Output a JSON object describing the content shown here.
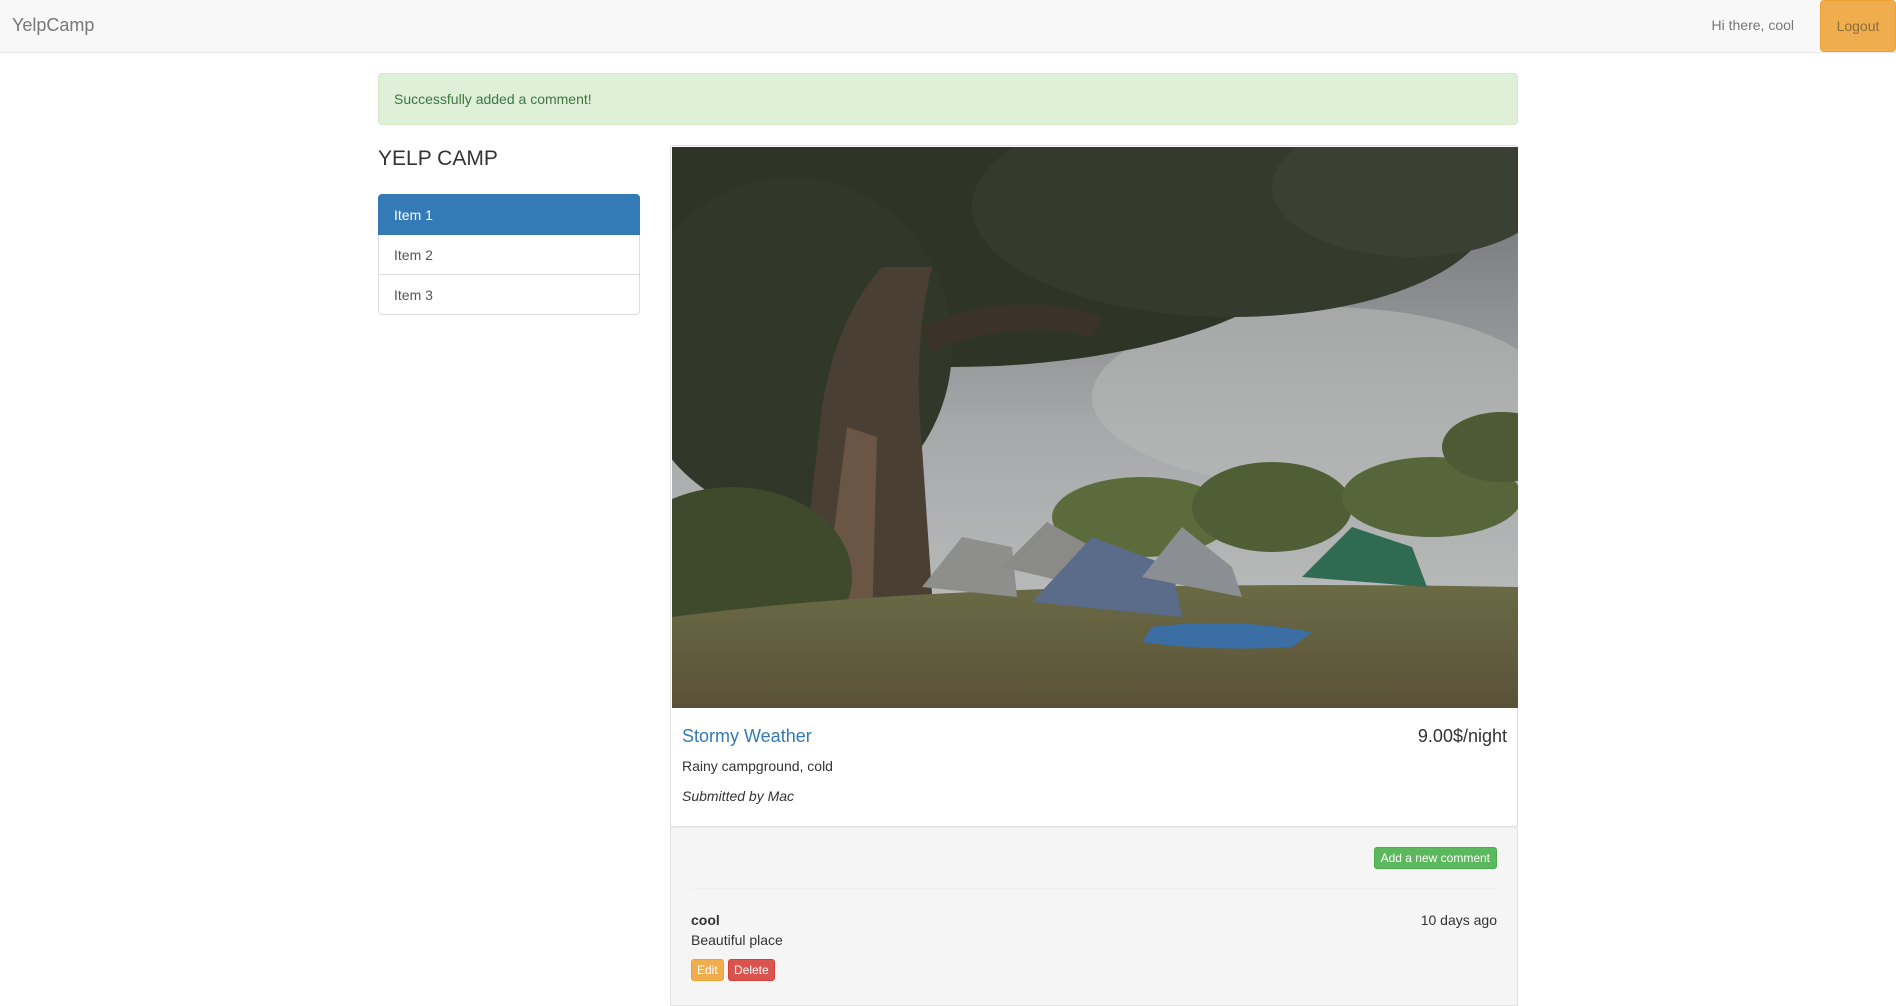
{
  "navbar": {
    "brand": "YelpCamp",
    "greeting": "Hi there, cool",
    "logout_label": "Logout"
  },
  "alert": {
    "message": "Successfully added a comment!"
  },
  "sidebar": {
    "heading": "YELP CAMP",
    "items": [
      {
        "label": "Item 1",
        "active": true
      },
      {
        "label": "Item 2",
        "active": false
      },
      {
        "label": "Item 3",
        "active": false
      }
    ]
  },
  "campground": {
    "name": "Stormy Weather",
    "price": "9.00$/night",
    "description": "Rainy campground, cold",
    "submitted_by": "Submitted by Mac"
  },
  "comments": {
    "add_button_label": "Add a new comment",
    "items": [
      {
        "author": "cool",
        "time": "10 days ago",
        "text": "Beautiful place",
        "edit_label": "Edit",
        "delete_label": "Delete"
      }
    ]
  },
  "colors": {
    "primary": "#337ab7",
    "success": "#5cb85c",
    "warning": "#f0ad4e",
    "danger": "#d9534f",
    "alert_bg": "#dff0d8"
  }
}
